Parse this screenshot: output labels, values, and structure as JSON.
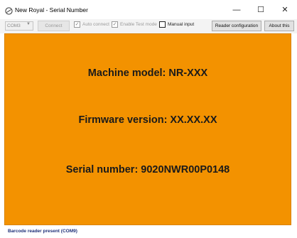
{
  "window": {
    "title": "New Royal - Serial Number",
    "minimize_glyph": "—",
    "maximize_glyph": "☐",
    "close_glyph": "✕"
  },
  "toolbar": {
    "port_value": "COM3",
    "connect_label": "Connect",
    "auto_connect_label": "Auto connect",
    "auto_connect_checked": true,
    "test_mode_label": "Enable Test mode",
    "test_mode_checked": true,
    "manual_input_label": "Manual input",
    "manual_input_checked": false,
    "reader_config_label": "Reader configuration",
    "about_label": "About this"
  },
  "panel": {
    "background": "#f39200",
    "machine_model": "Machine model: NR-XXX",
    "firmware_version": "Firmware version: XX.XX.XX",
    "serial_number": "Serial number: 9020NWR00P0148"
  },
  "status_bar": {
    "text": "Barcode reader present (COM9)",
    "color": "#1e2f78"
  }
}
